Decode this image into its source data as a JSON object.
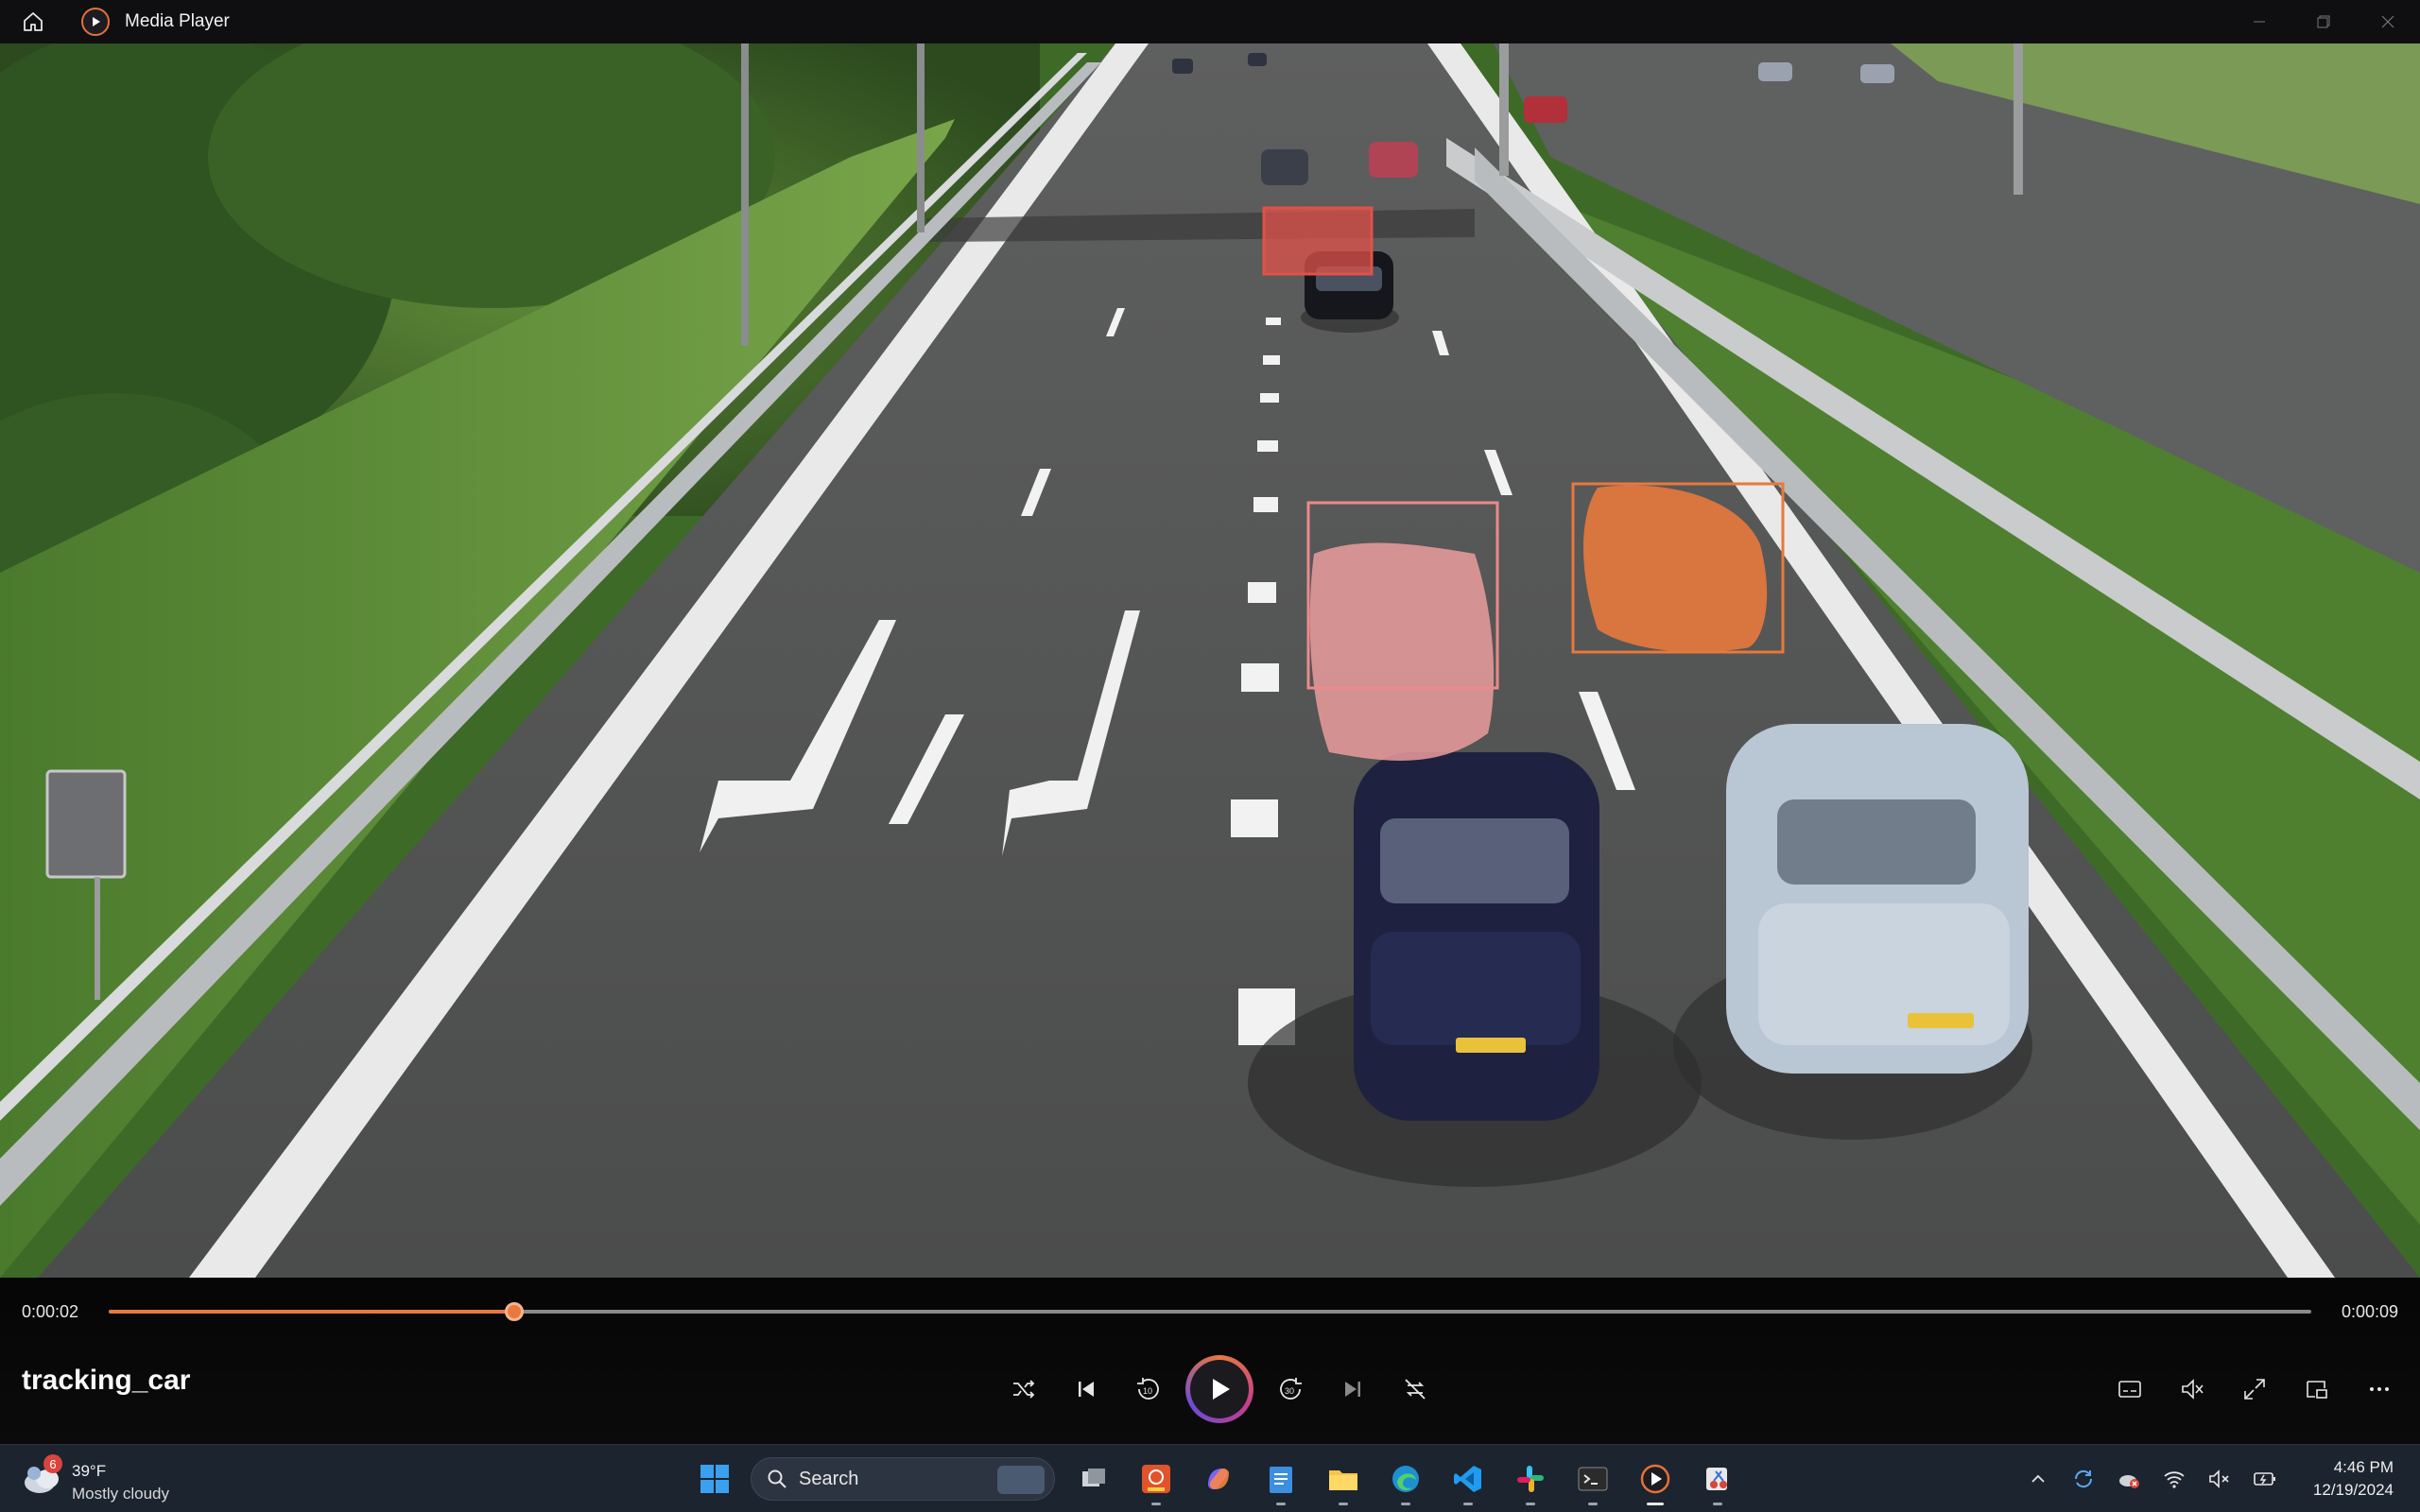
{
  "window": {
    "title": "Media Player"
  },
  "player": {
    "current_time": "0:00:02",
    "total_time": "0:00:09",
    "progress": 0.184,
    "media_title": "tracking_car",
    "accent_color": "#e8793d"
  },
  "detections": [
    {
      "label": "car",
      "color": "#e0524a"
    },
    {
      "label": "car",
      "color": "#eb9c9c"
    },
    {
      "label": "car",
      "color": "#e8793d"
    }
  ],
  "taskbar": {
    "weather": {
      "temp": "39°F",
      "condition": "Mostly cloudy",
      "badge": "6"
    },
    "search_placeholder": "Search",
    "clock": {
      "time": "4:46 PM",
      "date": "12/19/2024"
    }
  }
}
